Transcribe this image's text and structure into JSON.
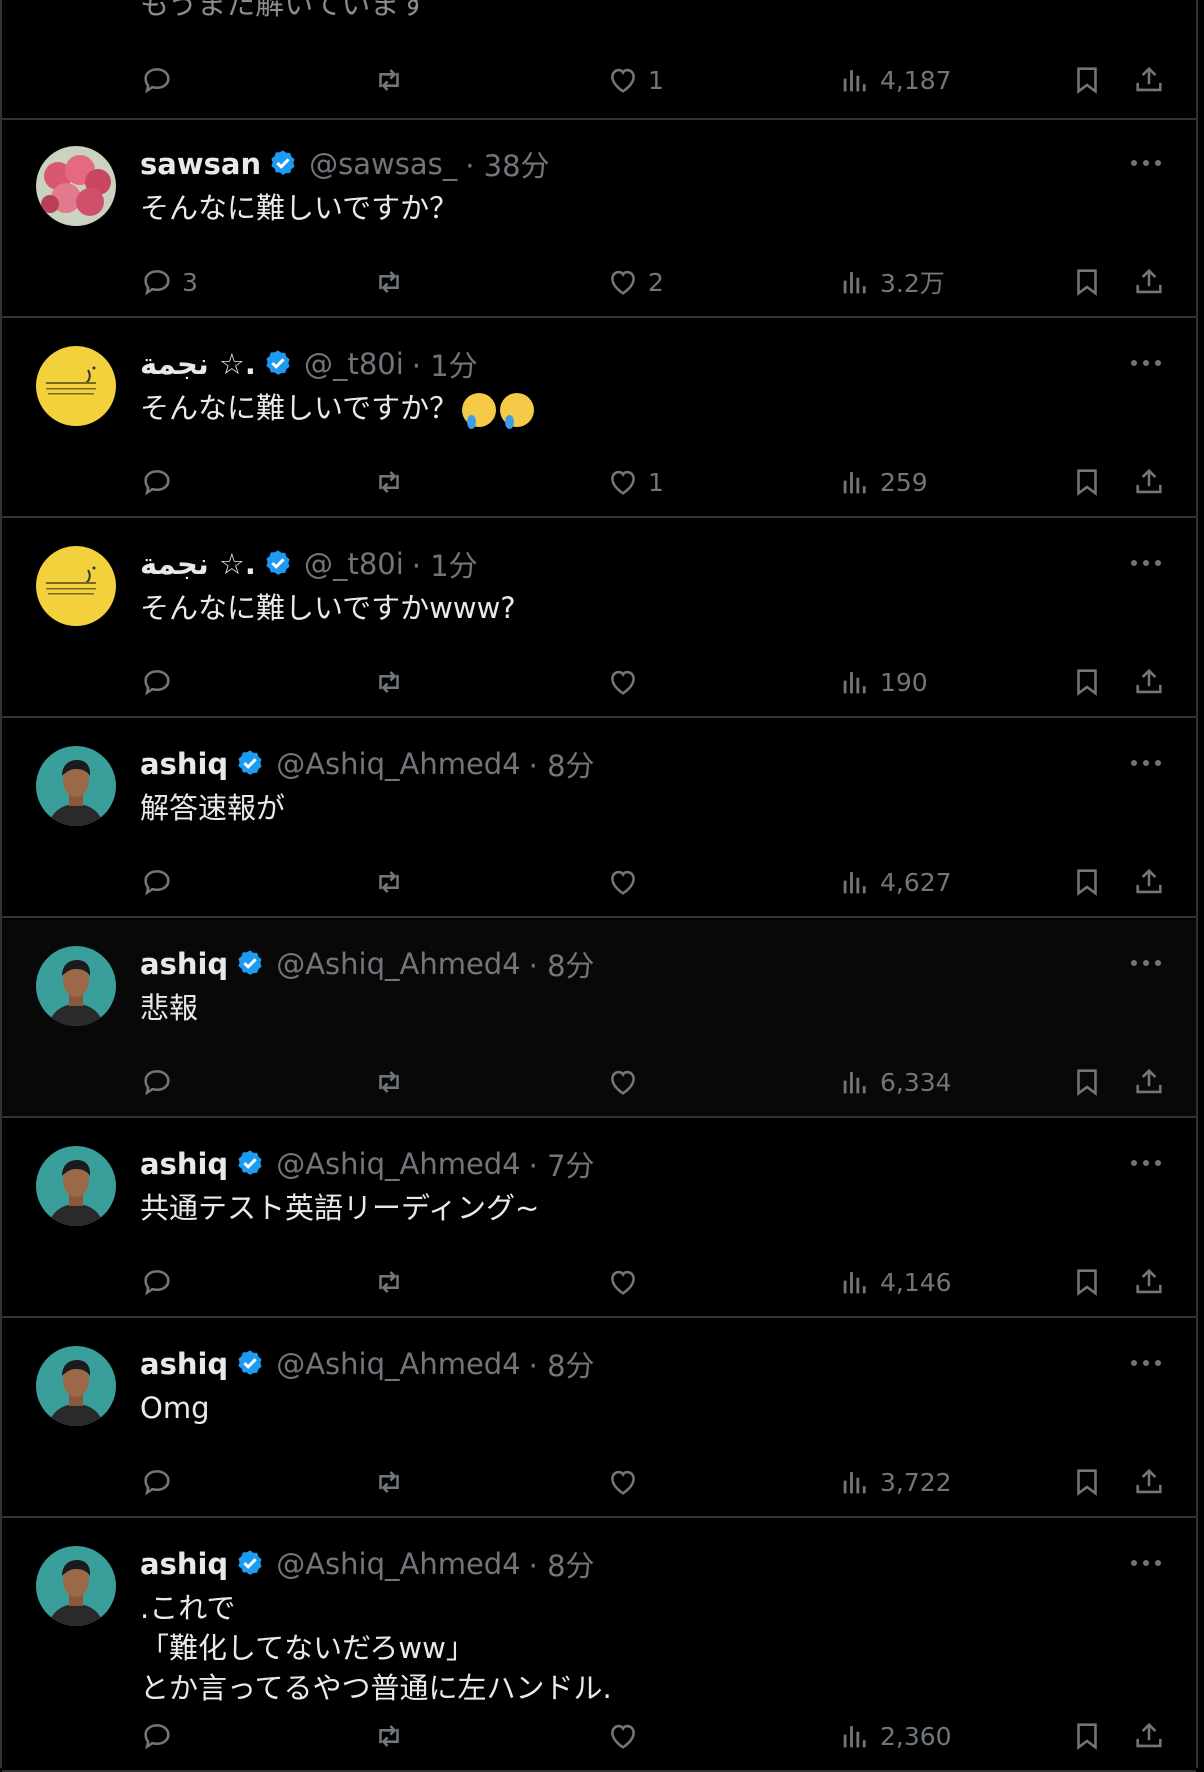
{
  "top_partial": {
    "text": "もうまた解いています",
    "likes": "1",
    "views": "4,187"
  },
  "colors": {
    "accent": "#1d9bf0",
    "muted": "#71767b",
    "border": "#2f3336"
  },
  "icons": [
    "reply-icon",
    "retweet-icon",
    "like-icon",
    "views-icon",
    "bookmark-icon",
    "share-icon",
    "more-icon",
    "verified-icon"
  ],
  "tweets": [
    {
      "name": "sawsan",
      "handle": "@sawsas_",
      "time": "· 38分",
      "text": "そんなに難しいですか？",
      "replies": "3",
      "likes": "2",
      "views": "3.2万",
      "avatar": "flowers"
    },
    {
      "name": "نجمة ☆.",
      "handle": "@_t80i",
      "time": "· 1分",
      "text": "そんなに難しいですか？",
      "emoji_count": 2,
      "replies": "",
      "likes": "1",
      "views": "259",
      "avatar": "yellow"
    },
    {
      "name": "نجمة ☆.",
      "handle": "@_t80i",
      "time": "· 1分",
      "text": "そんなに難しいですかwww?",
      "replies": "",
      "likes": "",
      "views": "190",
      "avatar": "yellow"
    },
    {
      "name": "ashiq",
      "handle": "@Ashiq_Ahmed4",
      "time": "· 8分",
      "text": "解答速報が",
      "replies": "",
      "likes": "",
      "views": "4,627",
      "avatar": "person"
    },
    {
      "name": "ashiq",
      "handle": "@Ashiq_Ahmed4",
      "time": "· 8分",
      "text": "悲報",
      "replies": "",
      "likes": "",
      "views": "6,334",
      "avatar": "person"
    },
    {
      "name": "ashiq",
      "handle": "@Ashiq_Ahmed4",
      "time": "· 7分",
      "text": "共通テスト英語リーディング~",
      "replies": "",
      "likes": "",
      "views": "4,146",
      "avatar": "person"
    },
    {
      "name": "ashiq",
      "handle": "@Ashiq_Ahmed4",
      "time": "· 8分",
      "text": "Omg",
      "replies": "",
      "likes": "",
      "views": "3,722",
      "avatar": "person"
    },
    {
      "name": "ashiq",
      "handle": "@Ashiq_Ahmed4",
      "time": "· 8分",
      "text": ".これで\n「難化してないだろww」\nとか言ってるやつ普通に左ハンドル.",
      "replies": "",
      "likes": "",
      "views": "2,360",
      "avatar": "person"
    }
  ]
}
